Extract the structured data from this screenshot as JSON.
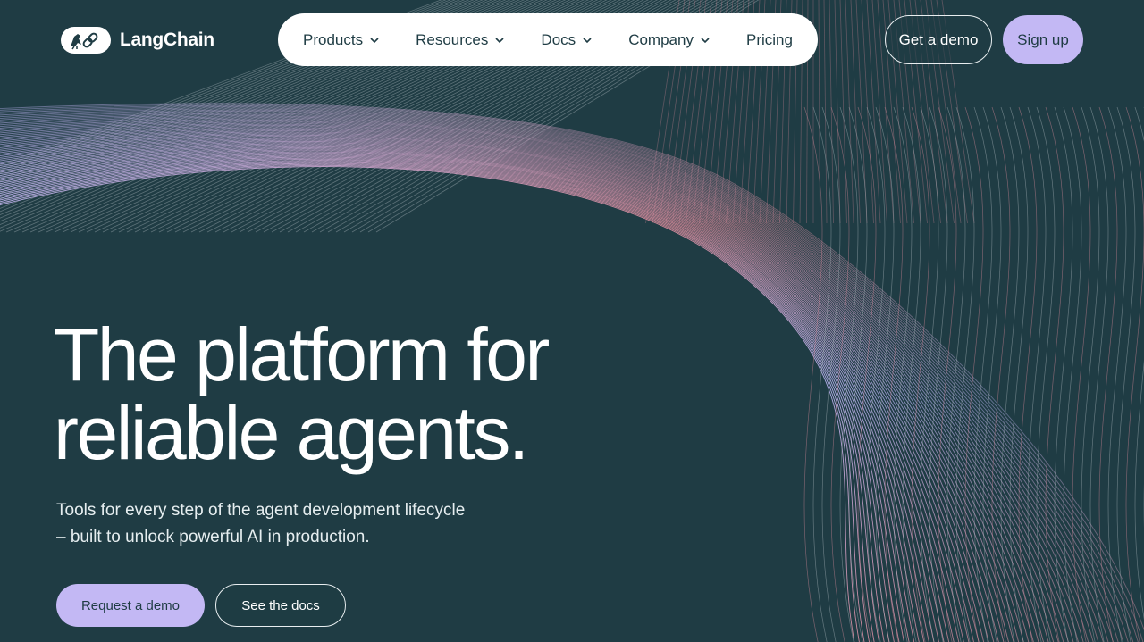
{
  "brand": {
    "name": "LangChain",
    "logo_icon": "parrot-chain-icon"
  },
  "nav": {
    "items": [
      {
        "label": "Products",
        "has_dropdown": true
      },
      {
        "label": "Resources",
        "has_dropdown": true
      },
      {
        "label": "Docs",
        "has_dropdown": true
      },
      {
        "label": "Company",
        "has_dropdown": true
      },
      {
        "label": "Pricing",
        "has_dropdown": false
      }
    ]
  },
  "header_actions": {
    "demo_label": "Get a demo",
    "signup_label": "Sign up"
  },
  "hero": {
    "title_line1": "The platform for",
    "title_line2": "reliable agents.",
    "subtitle_line1": "Tools for every step of the agent development lifecycle",
    "subtitle_line2": "– built to unlock powerful AI in production.",
    "primary_cta": "Request a demo",
    "secondary_cta": "See the docs"
  },
  "colors": {
    "background": "#1f3c44",
    "accent_lavender": "#c3b8f4",
    "line_lavender": "#b7b2f0",
    "line_pink": "#d98a9a",
    "line_grey": "#a9b5bb",
    "white": "#ffffff"
  }
}
